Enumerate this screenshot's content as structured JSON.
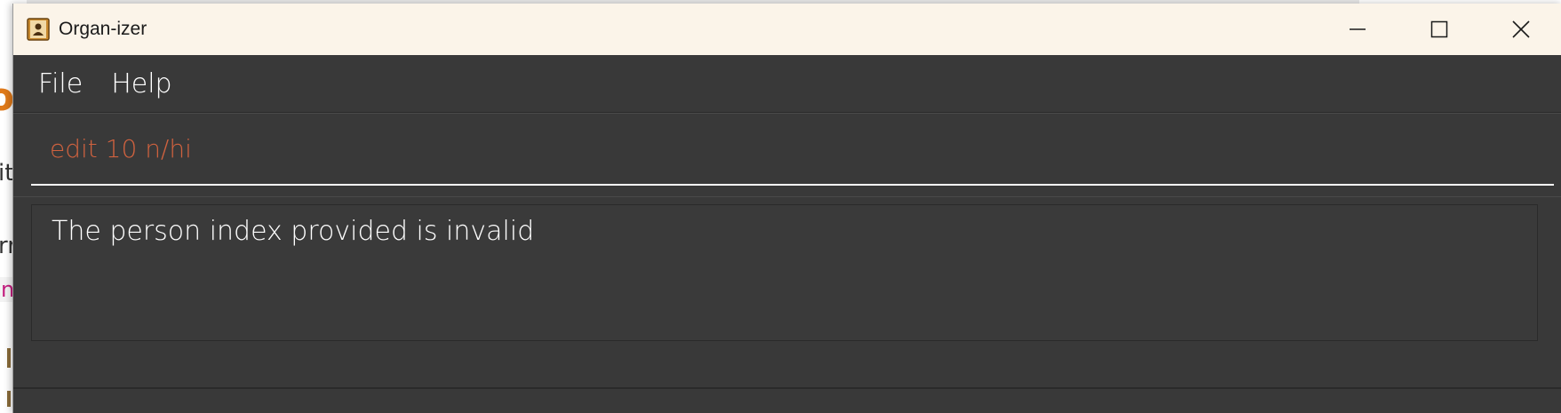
{
  "background": {
    "fragments": [
      "o",
      "it",
      "rr",
      "n/"
    ]
  },
  "window": {
    "title": "Organ-izer",
    "icon": "address-book-icon",
    "controls": {
      "minimize_icon": "minimize-icon",
      "maximize_icon": "maximize-icon",
      "close_icon": "close-icon"
    }
  },
  "menu": {
    "items": [
      {
        "label": "File"
      },
      {
        "label": "Help"
      }
    ]
  },
  "command": {
    "value": "edit 10 n/hi",
    "text_color": "#d0623f"
  },
  "result": {
    "message": "The person index provided is invalid"
  },
  "colors": {
    "window_bg": "#393939",
    "titlebar_bg": "#fbf4e9",
    "error_text": "#d0623f"
  }
}
